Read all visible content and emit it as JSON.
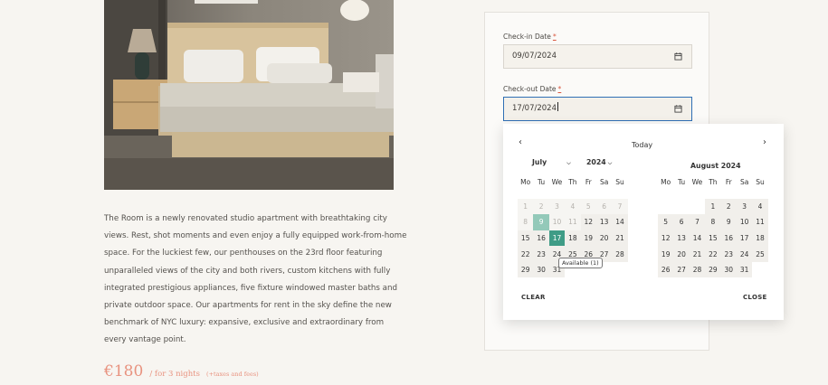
{
  "description": "The Room is a newly renovated studio apartment with breathtaking city views. Rest, shot moments and even enjoy a fully equipped work-from-home space. For the luckiest few, our penthouses on the 23rd floor featuring unparalleled views of the city and both rivers, custom kitchens with fully integrated prestigious appliances, five fixture windowed master baths and private outdoor space. Our apartments for rent in the sky define the new benchmark of NYC luxury: expansive, exclusive and extraordinary from every vantage point.",
  "price": {
    "amount": "€180",
    "per": "/ for 3 nights",
    "taxes": "(+taxes and fees)"
  },
  "booking": {
    "checkin_label": "Check-in Date",
    "checkout_label": "Check-out Date",
    "required_mark": "*",
    "checkin_value": "09/07/2024",
    "checkout_value": "17/07/2024"
  },
  "calendar": {
    "prev": "‹",
    "next": "›",
    "today": "Today",
    "month_left": "July",
    "year_left": "2024",
    "month_right_title": "August 2024",
    "weekdays": [
      "Mo",
      "Tu",
      "We",
      "Th",
      "Fr",
      "Sa",
      "Su"
    ],
    "july": [
      [
        "1",
        "2",
        "3",
        "4",
        "5",
        "6",
        "7"
      ],
      [
        "8",
        "9",
        "10",
        "11",
        "12",
        "13",
        "14"
      ],
      [
        "15",
        "16",
        "17",
        "18",
        "19",
        "20",
        "21"
      ],
      [
        "22",
        "23",
        "24",
        "25",
        "26",
        "27",
        "28"
      ],
      [
        "29",
        "30",
        "31",
        "",
        "",
        "",
        ""
      ]
    ],
    "july_past_days": [
      "1",
      "2",
      "3",
      "4",
      "5",
      "6",
      "7",
      "8",
      "10",
      "11"
    ],
    "july_range_start": "9",
    "july_range_end": "17",
    "august": [
      [
        "",
        "",
        "",
        "1",
        "2",
        "3",
        "4"
      ],
      [
        "5",
        "6",
        "7",
        "8",
        "9",
        "10",
        "11"
      ],
      [
        "12",
        "13",
        "14",
        "15",
        "16",
        "17",
        "18"
      ],
      [
        "19",
        "20",
        "21",
        "22",
        "23",
        "24",
        "25"
      ],
      [
        "26",
        "27",
        "28",
        "29",
        "30",
        "31",
        ""
      ]
    ],
    "tooltip": "Available (1)",
    "clear": "CLEAR",
    "close": "CLOSE"
  },
  "colors": {
    "range_start": "#93c9b9",
    "range_end": "#3f9c86",
    "price": "#e8927f",
    "focus_border": "#2f6fb5"
  }
}
